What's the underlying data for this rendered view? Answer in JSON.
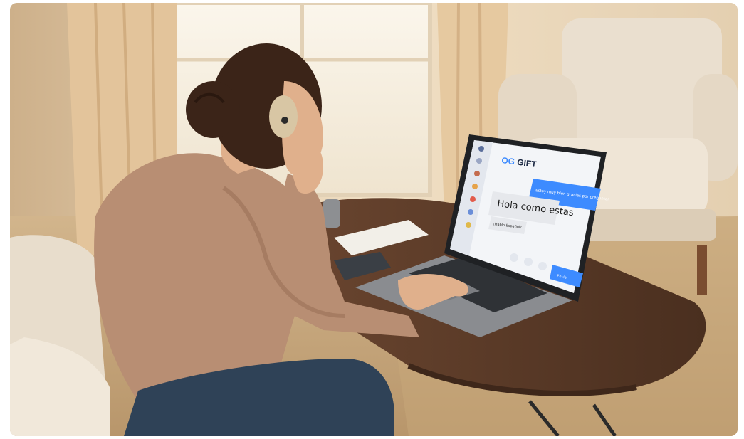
{
  "scene": {
    "description_tags": [
      "living-room",
      "person-at-laptop",
      "chat-app"
    ],
    "colors": {
      "wall": "#ead6b6",
      "curtain": "#e7c9a0",
      "floor": "#c9a97f",
      "table": "#5a3a25",
      "sweater": "#b88e73",
      "jeans": "#2f4257",
      "hair": "#3b2418",
      "skin": "#e0b08c",
      "device": "#d8c6a4",
      "laptop": "#6d6f73",
      "chat_accent": "#3d8bff"
    }
  },
  "laptop_screen": {
    "app_logo": "GIFT",
    "sidebar_items": [
      "",
      "",
      "",
      "",
      "",
      "",
      ""
    ],
    "outgoing_message": "Estoy muy bien gracias por preguntar",
    "incoming_message": "Hola como estas",
    "incoming_small": "¿Hablo Español?",
    "send_button_label": "Enviar"
  }
}
